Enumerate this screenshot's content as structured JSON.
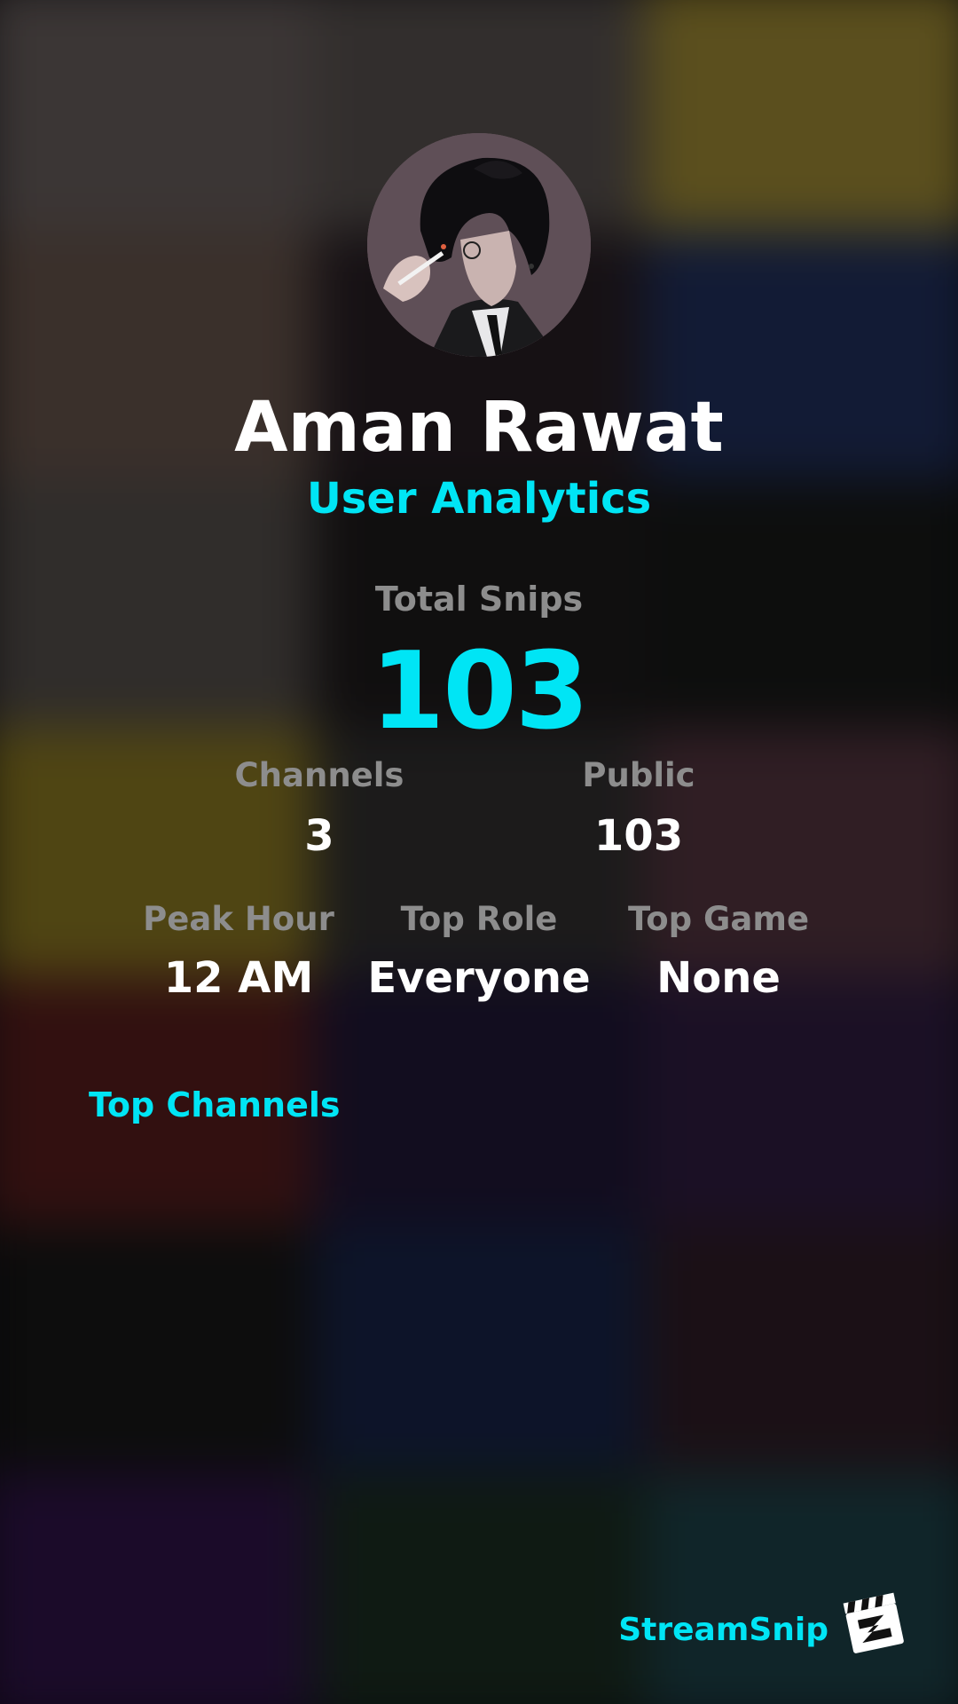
{
  "theme": {
    "accent": "#00e5f5",
    "label_gray": "#8d8d8d",
    "text_white": "#ffffff"
  },
  "profile": {
    "name": "Aman Rawat",
    "subtitle": "User Analytics",
    "avatar_icon": "user-avatar-illustration"
  },
  "stats": {
    "total_snips": {
      "label": "Total Snips",
      "value": "103"
    },
    "channels": {
      "label": "Channels",
      "value": "3"
    },
    "public": {
      "label": "Public",
      "value": "103"
    },
    "peak_hour": {
      "label": "Peak Hour",
      "value": "12 AM"
    },
    "top_role": {
      "label": "Top Role",
      "value": "Everyone"
    },
    "top_game": {
      "label": "Top Game",
      "value": "None"
    }
  },
  "top_channels": {
    "title": "Top Channels"
  },
  "brand": {
    "name": "StreamSnip",
    "logo_icon": "clapperboard-icon"
  }
}
